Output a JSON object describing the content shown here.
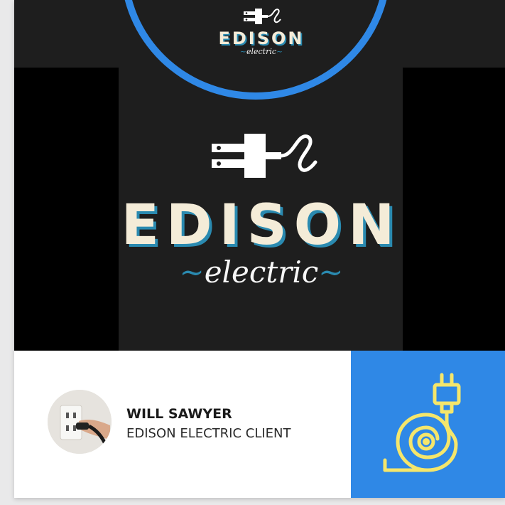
{
  "brand": {
    "name": "EDISON",
    "tagline": "electric",
    "colors": {
      "accent_blue": "#2f88e6",
      "cream": "#f4ecd8",
      "shadow_blue": "#2a8ab0",
      "dark": "#1e1e1e",
      "icon_yellow": "#f5e66b"
    }
  },
  "testimonial": {
    "name": "WILL SAWYER",
    "role": "EDISON ELECTRIC CLIENT",
    "avatar_icon": "hand-plugging-outlet-photo"
  },
  "icons": {
    "plug_logo": "plug-icon",
    "cable": "cable-plug-icon"
  }
}
